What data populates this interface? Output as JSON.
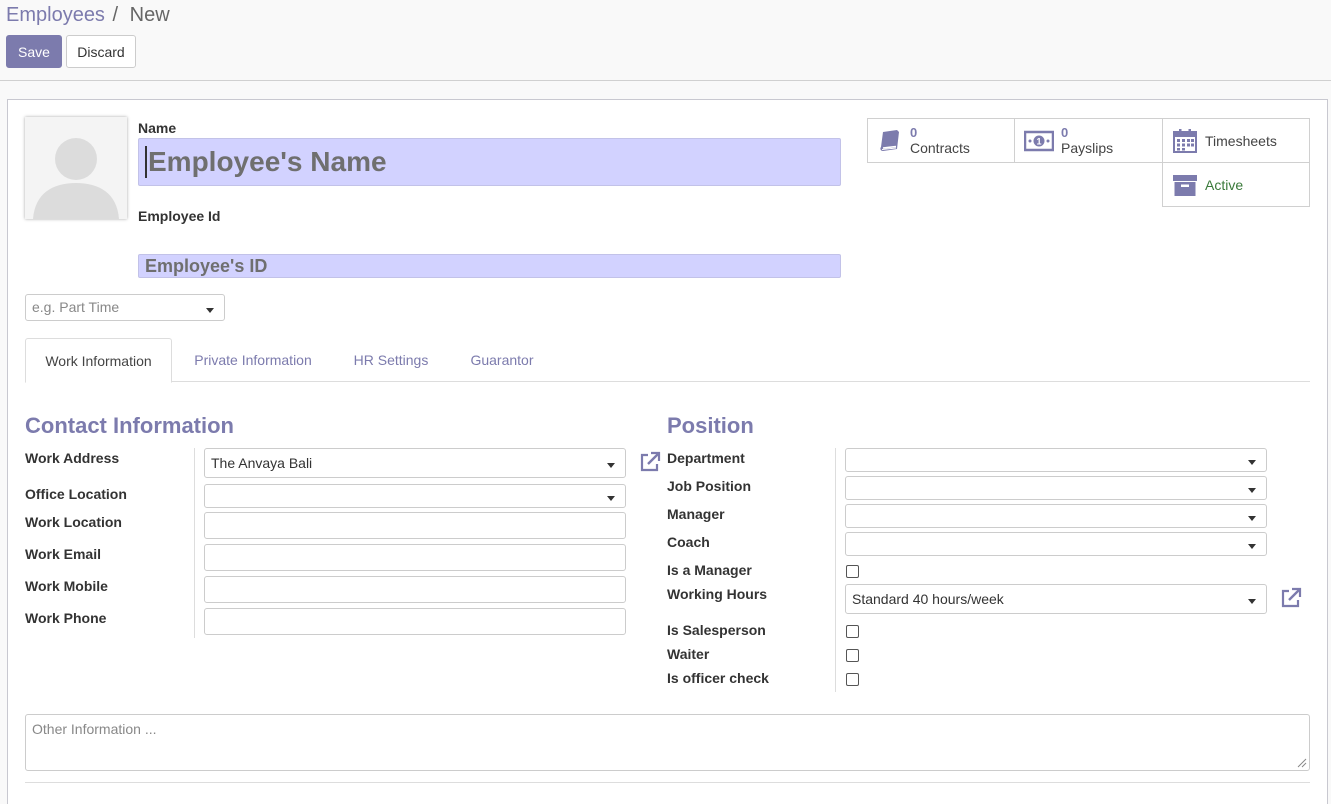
{
  "breadcrumb": {
    "parent": "Employees",
    "separator": "/",
    "current": "New"
  },
  "buttons": {
    "save": "Save",
    "discard": "Discard"
  },
  "header": {
    "name_label": "Name",
    "name_placeholder": "Employee's Name",
    "employee_id_label": "Employee Id",
    "employee_id_placeholder": "Employee's ID",
    "type_placeholder": "e.g. Part Time"
  },
  "smart_buttons": {
    "contracts": {
      "count": "0",
      "label": "Contracts",
      "icon": "book-icon"
    },
    "payslips": {
      "count": "0",
      "label": "Payslips",
      "icon": "money-icon"
    },
    "timesheets": {
      "label": "Timesheets",
      "icon": "calendar-icon"
    },
    "active": {
      "label": "Active",
      "icon": "archive-icon"
    }
  },
  "tabs": [
    "Work Information",
    "Private Information",
    "HR Settings",
    "Guarantor"
  ],
  "contact": {
    "title": "Contact Information",
    "work_address_label": "Work Address",
    "work_address_value": "The Anvaya Bali",
    "office_location_label": "Office Location",
    "work_location_label": "Work Location",
    "work_email_label": "Work Email",
    "work_mobile_label": "Work Mobile",
    "work_phone_label": "Work Phone"
  },
  "position": {
    "title": "Position",
    "department_label": "Department",
    "job_position_label": "Job Position",
    "manager_label": "Manager",
    "coach_label": "Coach",
    "is_manager_label": "Is a Manager",
    "working_hours_label": "Working Hours",
    "working_hours_value": "Standard 40 hours/week",
    "is_salesperson_label": "Is Salesperson",
    "waiter_label": "Waiter",
    "is_officer_check_label": "Is officer check"
  },
  "notes": {
    "placeholder": "Other Information ..."
  },
  "colors": {
    "accent": "#7c7bad",
    "required_bg": "#d2d2ff",
    "active_green": "#3a7a3a"
  }
}
